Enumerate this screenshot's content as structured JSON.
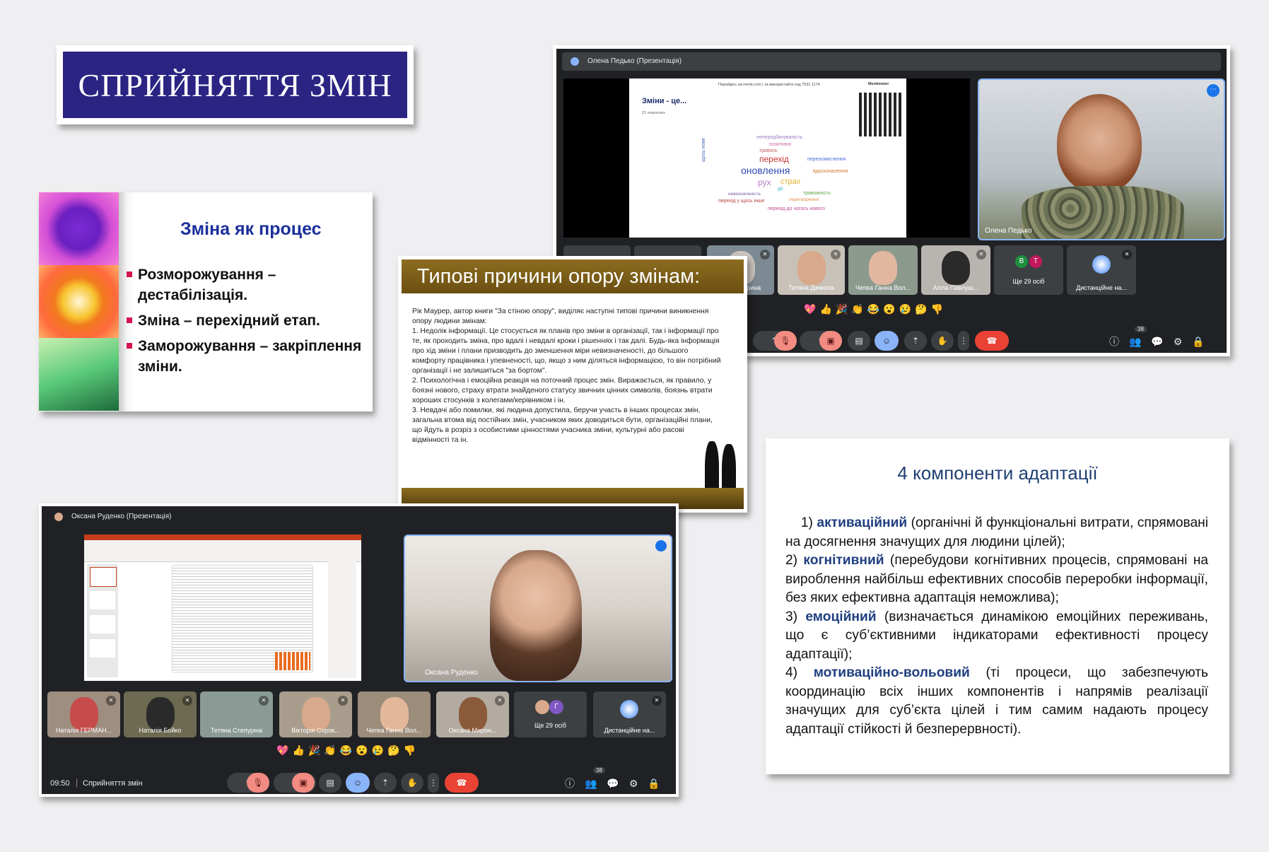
{
  "title_card": {
    "text": "СПРИЙНЯТТЯ ЗМІН"
  },
  "slide_process": {
    "title": "Зміна як процес",
    "items": [
      "Розморожування – дестабілізація.",
      "Зміна – перехідний етап.",
      "Заморожування – закріплення зміни."
    ]
  },
  "meet_top": {
    "header": "Олена Педько (Презентація)",
    "mentimeter": {
      "instruction": "Перейдіть на menti.com | та використайте код  7531 1174",
      "brand": "Mentimeter",
      "question": "Зміни - це...",
      "responses": "21 responses",
      "words": [
        "непередбачуваність",
        "позитивні",
        "тривога",
        "перехід",
        "переосмислення",
        "оновлення",
        "вдосконалення",
        "рух",
        "страх",
        "дії",
        "невизначеність",
        "тривожність",
        "перехід у щось інше",
        "перетворення",
        "перехід до чогось нового",
        "щось нове"
      ]
    },
    "speaker_name": "Олена Педько",
    "tiles": [
      "на Степурина",
      "Тетяна Джмола",
      "Чепка Ганна Вол...",
      "Алла Павлуш...",
      "Ще 29 осіб",
      "Дистанційне на..."
    ],
    "more_avatars": [
      "В",
      "Т"
    ],
    "participants_count": "38"
  },
  "slide_reasons": {
    "title": "Типові причини опору змінам:",
    "paragraphs": [
      "Рік Маурер,  автор книги \"За стіною опору\",  виділяє наступні типові причини виникнення опору людини змінам:",
      "1. Недолік інформації. Це стосується як планів про зміни в організації, так і інформації про те, як проходить зміна, про вдалі і невдалі кроки і рішеннях і так далі. Будь-яка інформація про хід зміни і плани призводить до зменшення міри невизначеності, до більшого комфорту працівника і упевненості, що, якщо з ним діляться інформацією, то він потрібний організації і не залишиться \"за бортом\".",
      "2. Психологічна і емоційна реакція на поточний процес змін. Виражається,  як правило,  у боязні нового,  страху втрати знайденого статусу звичних цінних символів,  боязнь втрати хороших стосунків з колегами/керівником і ін.",
      "3.  Невдачі або помилки, які людина допустила,  беручи участь в інших процесах змін,  загальна втома від постійних змін,  учасником яких доводиться бути, організаційні плани,  що йдуть в розріз з особистими цінностями учасника зміни, культурні або расові відмінності та ін."
    ]
  },
  "meet_bottom": {
    "header": "Оксана Руденко (Презентація)",
    "speaker_name": "Оксана Руденко",
    "tiles": [
      "Наталія ГЕРМАН...",
      "Наталія Бойко",
      "Тетяна Степуріна",
      "Вікторія Сорок...",
      "Чепка Ганна Вол...",
      "Оксана Мирон...",
      "Ще 29 осіб",
      "Дистанційне на..."
    ],
    "more_avatars": [
      "Г"
    ],
    "time": "09:50",
    "meeting_title": "Сприйняття змін",
    "participants_count": "38"
  },
  "slide_adapt": {
    "title": "4 компоненти адаптації",
    "items": [
      {
        "prefix": "1) ",
        "term": "активаційний",
        "text": " (органічні й функціональні витрати, спрямовані на досягнення значущих для людини цілей);"
      },
      {
        "prefix": "2) ",
        "term": "когнітивний",
        "text": " (перебудови когнітивних процесів, спрямовані на вироблення найбільш ефективних способів переробки інформації, без яких ефективна адаптація неможлива);"
      },
      {
        "prefix": "3) ",
        "term": "емоційний",
        "text": " (визначається динамікою емоційних переживань, що є суб’єктивними індикаторами ефективності процесу адаптації);"
      },
      {
        "prefix": "4) ",
        "term": "мотиваційно-вольовий",
        "text": " (ті процеси, що забезпечують координацію всіх інших компонентів і напрямів реалізації значущих для суб’єкта цілей і тим самим надають процесу адаптації стійкості й безперервності)."
      }
    ]
  },
  "reactions": [
    "💖",
    "👍",
    "🎉",
    "👏",
    "😂",
    "😮",
    "😢",
    "🤔",
    "👎"
  ]
}
